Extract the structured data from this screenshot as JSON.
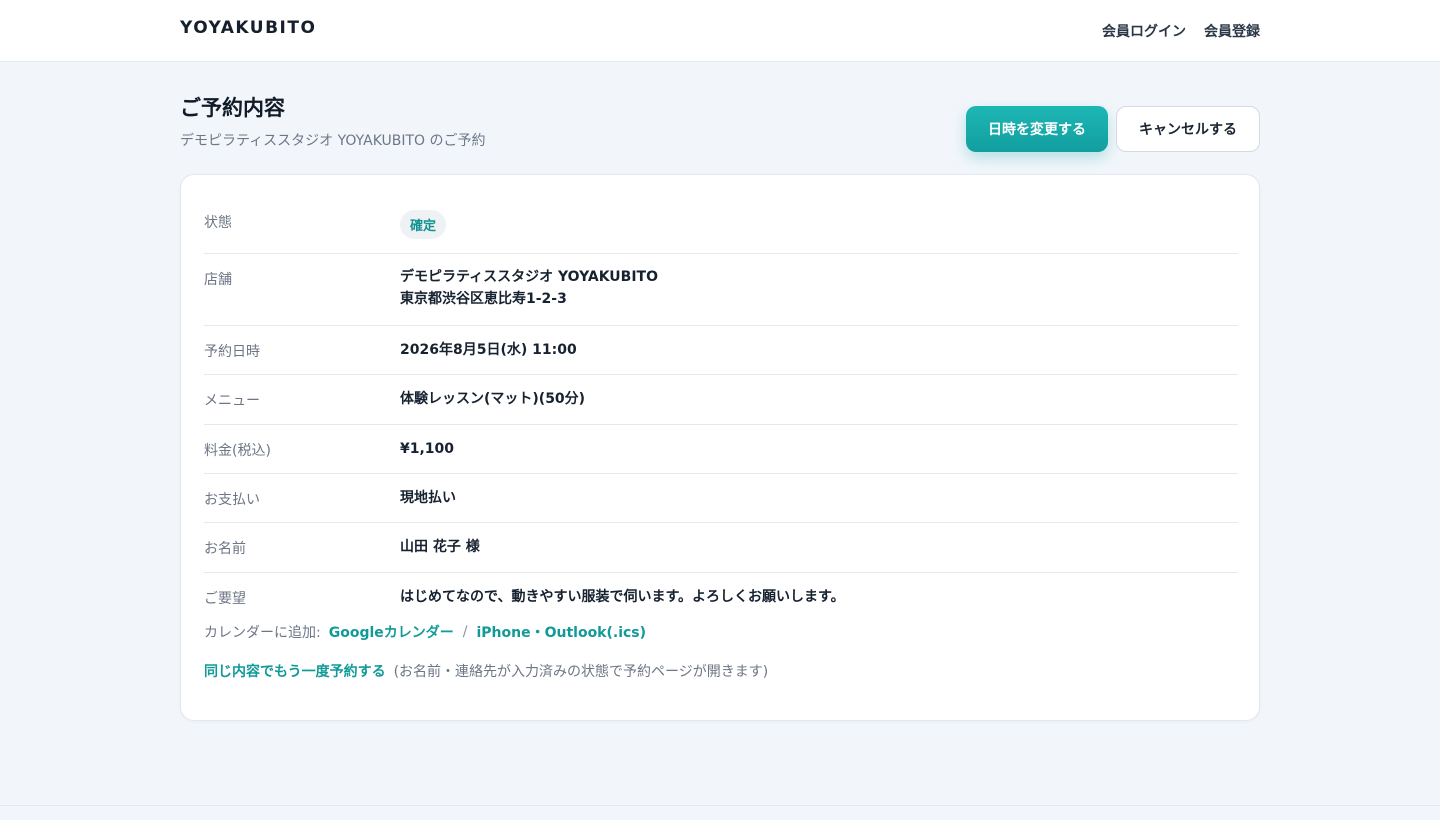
{
  "header": {
    "brand": "YOYAKUBITO",
    "nav": [
      "会員ログイン",
      "会員登録"
    ]
  },
  "page": {
    "title": "ご予約内容",
    "subtitle": "デモピラティススタジオ YOYAKUBITO のご予約",
    "change_button": "日時を変更する",
    "cancel_button": "キャンセルする"
  },
  "details": {
    "status": {
      "label": "状態",
      "value": "確定"
    },
    "store": {
      "label": "店舗",
      "name": "デモピラティススタジオ YOYAKUBITO",
      "address": "東京都渋谷区恵比寿1-2-3"
    },
    "datetime": {
      "label": "予約日時",
      "value": "2026年8月5日(水) 11:00"
    },
    "menu": {
      "label": "メニュー",
      "value": "体験レッスン(マット)(50分)"
    },
    "price": {
      "label": "料金(税込)",
      "value": "¥1,100"
    },
    "payment": {
      "label": "お支払い",
      "value": "現地払い"
    },
    "name": {
      "label": "お名前",
      "value": "山田 花子 様"
    },
    "request": {
      "label": "ご要望",
      "value": "はじめてなので、動きやすい服装で伺います。よろしくお願いします。"
    }
  },
  "calendar": {
    "label": "カレンダーに追加:",
    "google": "Googleカレンダー",
    "separator": "/",
    "ics": "iPhone・Outlook(.ics)"
  },
  "rebook": {
    "link": "同じ内容でもう一度予約する",
    "note": "(お名前・連絡先が入力済みの状態で予約ページが開きます)"
  },
  "colors": {
    "accent": "#129e9f",
    "background": "#f2f6fb",
    "text": "#172231",
    "muted": "#6d7685"
  }
}
